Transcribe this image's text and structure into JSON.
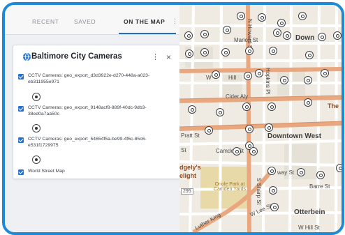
{
  "tabs": [
    {
      "label": "RECENT"
    },
    {
      "label": "SAVED"
    },
    {
      "label": "ON THE MAP"
    }
  ],
  "tabs_more_icon": "more-vertical-icon",
  "card": {
    "title": "Baltimore City Cameras",
    "kebab": "⋮",
    "close": "×",
    "layers": [
      {
        "label": "CCTV Cameras: geo_export_d3d3922e-d270-448a-a023-eb311955e971",
        "checked": true
      },
      {
        "label": "CCTV Cameras: geo_export_9148acf8-889f-40dc-9db3-38ed0a7aa50c",
        "checked": true
      },
      {
        "label": "CCTV Cameras: geo_export_54654f5a-be99-4f6c-85c6-e531f1729975",
        "checked": true
      },
      {
        "label": "World Street Map",
        "checked": true
      }
    ]
  },
  "map": {
    "labels": {
      "marion": "Marion St",
      "downtown": "Down",
      "w": "W",
      "hill": "Hill",
      "cider": "Cider Aly",
      "pratt": "Pratt St",
      "camden": "Camden St",
      "downtown_west": "Downtown West",
      "dgely": "dgely's",
      "elight": "elight",
      "route": "295",
      "park": "Oriole Park at Camden Yards",
      "way": "way St",
      "barre": "Barre St",
      "otterbein": "Otterbein",
      "lee": "W Lee St",
      "hill_st": "W Hill St",
      "luther": "Luther King",
      "the": "The",
      "sharp": "S Sharp St",
      "hopkins": "Hopkins Pl",
      "howard": "N Howard St",
      "st": "St"
    },
    "colors": {
      "background": "#f0ebe2",
      "major_road": "#e8a77e",
      "minor_road": "#ffffff",
      "park": "#e8d9a9",
      "block": "#e6e1d6"
    }
  }
}
